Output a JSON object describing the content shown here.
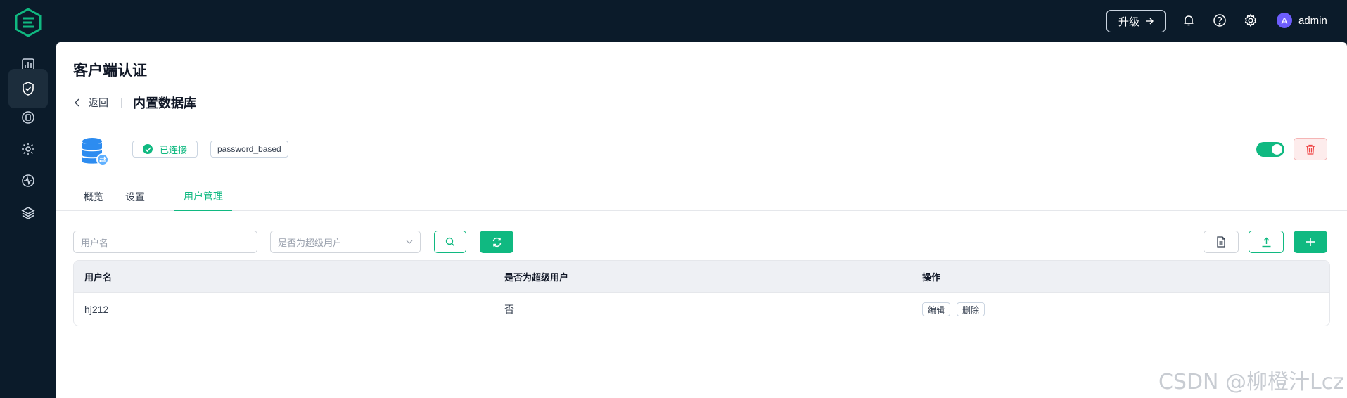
{
  "header": {
    "upgrade_label": "升级",
    "username": "admin",
    "avatar_letter": "A"
  },
  "page": {
    "title": "客户端认证",
    "back_label": "返回",
    "sub_title": "内置数据库",
    "status": "已连接",
    "mechanism": "password_based",
    "enabled": true
  },
  "tabs": [
    {
      "label": "概览",
      "active": false
    },
    {
      "label": "设置",
      "active": false
    },
    {
      "label": "用户管理",
      "active": true
    }
  ],
  "filters": {
    "username_placeholder": "用户名",
    "superuser_placeholder": "是否为超级用户"
  },
  "table": {
    "columns": [
      "用户名",
      "是否为超级用户",
      "操作"
    ],
    "rows": [
      {
        "username": "hj212",
        "is_superuser": "否",
        "edit_label": "编辑",
        "delete_label": "删除"
      }
    ]
  },
  "watermark": "CSDN @柳橙汁Lcz",
  "colors": {
    "accent": "#10b981",
    "sidebar": "#0b1b2a",
    "danger": "#ef4444"
  }
}
